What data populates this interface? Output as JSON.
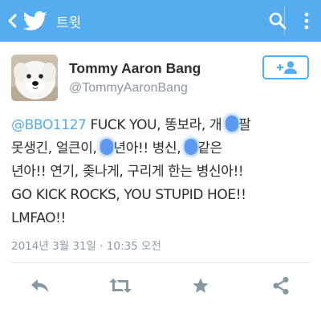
{
  "appbar": {
    "title": "트윗",
    "color": "#55acee",
    "icons": [
      "back-arrow-icon",
      "twitter-bird-icon",
      "search-icon",
      "overflow-menu-icon"
    ]
  },
  "author": {
    "name": "Tommy Aaron Bang",
    "handle": "@TommyAaronBang",
    "follow_icon": "add-person-icon"
  },
  "tweet": {
    "mention": "@BBO1127",
    "line1_rest": " FUCK YOU, 똥보라, 개 ",
    "line1_end": "팔",
    "line2_a": "못생긴, 얼큰이, ",
    "line2_b": "년아!!  병신, ",
    "line2_c": "같은",
    "line3": "년아!!  연기, 좆나게, 구리게 한는 병신아!!",
    "line4": "GO KICK ROCKS, YOU STUPID HOE!!",
    "line5": "LMFAO!!"
  },
  "timestamp": "2014년 3월 31일 · 10:35 오전",
  "actions": [
    "reply-icon",
    "retweet-icon",
    "favorite-star-icon",
    "share-icon"
  ]
}
